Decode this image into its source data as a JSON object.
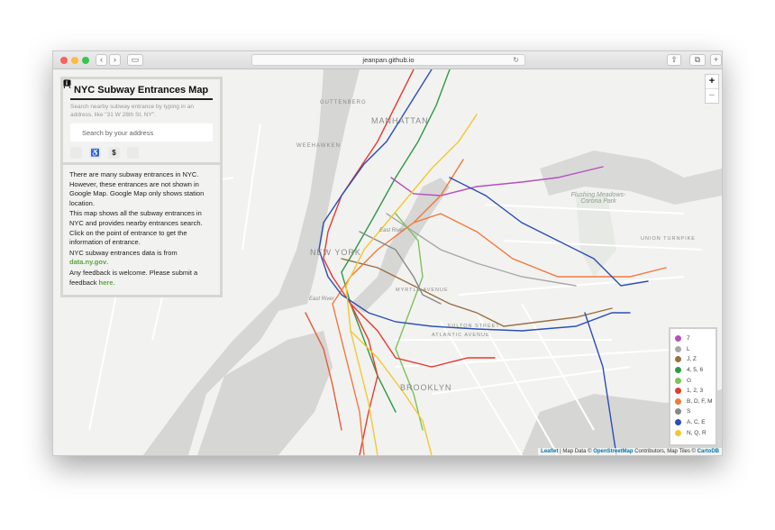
{
  "browser": {
    "url": "jeanpan.github.io",
    "reload_icon": "reload-icon"
  },
  "panel": {
    "title": "NYC Subway Entrances Map",
    "subtitle": "Search nearby subway entrance by typing in an address, like \"31 W 28th St, NY\".",
    "search_placeholder": "Search by your address",
    "filter_icons": [
      "subway-icon",
      "wheelchair-icon",
      "dollar-icon",
      "info-icon"
    ]
  },
  "info": {
    "p1": "There are many subway entrances in NYC. However, these entrances are not shown in Google Map. Google Map only shows station location.",
    "p2": "This map shows all the subway entrances in NYC and provides nearby entrances search. Click on the point of entrance to get the information of entrance.",
    "p3_text": "NYC subway entrances data is from",
    "p3_link": "data.ny.gov",
    "p3_end": ".",
    "p4_text": "Any feedback is welcome. Please submit a feedback",
    "p4_link": "here",
    "p4_end": "."
  },
  "map": {
    "labels": {
      "manhattan": "MANHATTAN",
      "newyork": "NEW YORK",
      "brooklyn": "BROOKLYN",
      "flushing": "Flushing Meadows-Corona Park",
      "weehawken": "WEEHAWKEN",
      "guttenberg": "GUTTENBERG",
      "eastriver": "East River",
      "eastriver2": "East River",
      "myrtle": "MYRTLE AVENUE",
      "fulton": "FULTON STREET",
      "atlantic": "ATLANTIC AVENUE",
      "union": "UNION TURNPIKE"
    },
    "zoom_in": "+",
    "zoom_out": "−"
  },
  "legend": [
    {
      "label": "7",
      "color": "#b64fbf"
    },
    {
      "label": "L",
      "color": "#a8a8a8"
    },
    {
      "label": "J, Z",
      "color": "#9a7040"
    },
    {
      "label": "4, 5, 6",
      "color": "#2f9a44"
    },
    {
      "label": "G",
      "color": "#7bc25b"
    },
    {
      "label": "1, 2, 3",
      "color": "#e53c30"
    },
    {
      "label": "B, D, F, M",
      "color": "#f07a3a"
    },
    {
      "label": "S",
      "color": "#888888"
    },
    {
      "label": "A, C, E",
      "color": "#2a4fb5"
    },
    {
      "label": "N, Q, R",
      "color": "#f2c82e"
    }
  ],
  "attribution": {
    "leaflet": "Leaflet",
    "mid1": " | Map Data © ",
    "osm": "OpenStreetMap",
    "mid2": " Contributors, Map Tiles © ",
    "carto": "CartoDB"
  }
}
